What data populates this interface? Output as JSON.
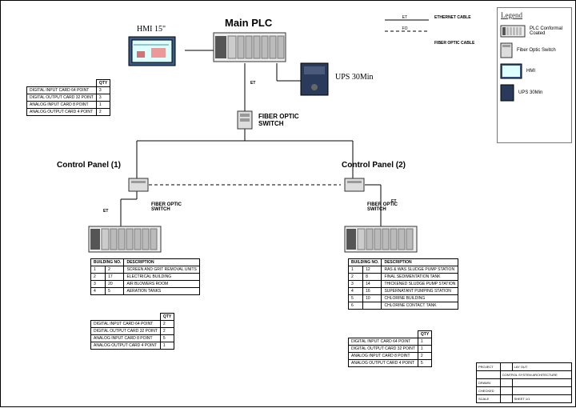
{
  "title_main": "Main  PLC",
  "hmi_label": "HMI 15\"",
  "ups_label": "UPS 30Min",
  "cable_legend": {
    "et_abbr": "ET",
    "et_name": "ETHERNET CABLE",
    "fo_abbr": "FO",
    "fo_name": "FIBER OPTIC CABLE"
  },
  "connection_labels": {
    "et1": "ET",
    "et2": "ET",
    "et3": "ET"
  },
  "fos_center": "FIBER OPTIC\nSWITCH",
  "cp1": "Control Panel (1)",
  "cp2": "Control Panel (2)",
  "fos1": "FIBER OPTIC\nSWITCH",
  "fos2": "FIBER OPTIC\nSWITCH",
  "cards_top": {
    "header_qty": "QTY",
    "rows": [
      {
        "name": "DIGITAL INPUT CARD 64 POINT",
        "qty": "3"
      },
      {
        "name": "DIGITAL OUTPUT CARD 32 POINT",
        "qty": "3"
      },
      {
        "name": "ANALOG INPUT CARD 8 POINT",
        "qty": "1"
      },
      {
        "name": "ANALOG OUTPUT CARD 4 POINT",
        "qty": "2"
      }
    ]
  },
  "panel1_bldg": {
    "hdr_col1": "BUILDING NO.",
    "hdr_col2": "DESCRIPTION",
    "rows": [
      {
        "a": "1",
        "b": "2",
        "desc": "SCREEN AND GRIT REMOVAL UNITS"
      },
      {
        "a": "2",
        "b": "17",
        "desc": "ELECTRICAL BUILDING"
      },
      {
        "a": "3",
        "b": "20",
        "desc": "AIR BLOWERS ROOM"
      },
      {
        "a": "4",
        "b": "5",
        "desc": "AERATION TANKS"
      }
    ]
  },
  "panel1_cards": {
    "header_qty": "QTY",
    "rows": [
      {
        "name": "DIGITAL INPUT CARD 64 POINT",
        "qty": "2"
      },
      {
        "name": "DIGITAL OUTPUT CARD 32 POINT",
        "qty": "2"
      },
      {
        "name": "ANALOG INPUT CARD 8 POINT",
        "qty": "5"
      },
      {
        "name": "ANALOG OUTPUT CARD 4 POINT",
        "qty": "1"
      }
    ]
  },
  "panel2_bldg": {
    "hdr_col1": "BUILDING NO.",
    "hdr_col2": "DESCRIPTION",
    "rows": [
      {
        "a": "1",
        "b": "12",
        "desc": "RAS & WAS SLUDGE PUMP STATION"
      },
      {
        "a": "2",
        "b": "8",
        "desc": "FINAL SEDIMENTATION TANK"
      },
      {
        "a": "3",
        "b": "14",
        "desc": "THICKENED SLUDGE PUMP STATION"
      },
      {
        "a": "4",
        "b": "16",
        "desc": "SUPERNATANT PUMPING STATION"
      },
      {
        "a": "5",
        "b": "10",
        "desc": "CHLORINE BUILDING"
      },
      {
        "a": "6",
        "b": "",
        "desc": "CHLORINE CONTACT TANK"
      }
    ]
  },
  "panel2_cards": {
    "header_qty": "QTY",
    "rows": [
      {
        "name": "DIGITAL INPUT CARD 64 POINT",
        "qty": "1"
      },
      {
        "name": "DIGITAL OUTPUT CARD 32 POINT",
        "qty": "1"
      },
      {
        "name": "ANALOG INPUT CARD 8 POINT",
        "qty": "2"
      },
      {
        "name": "ANALOG OUTPUT CARD 4 POINT",
        "qty": "5"
      }
    ]
  },
  "legend": {
    "title": "Legend",
    "items": [
      {
        "name": "PLC Conformal Coated"
      },
      {
        "name": "Fiber Optic Switch"
      },
      {
        "name": "HMI"
      },
      {
        "name": "UPS 30Min"
      }
    ]
  },
  "titleblock": {
    "rows": [
      [
        "PROJECT",
        "",
        "LAY OUT"
      ],
      [
        "",
        "CONTROL SYSTEM ARCHITECTURE",
        ""
      ],
      [
        "DRAWN",
        "",
        ""
      ],
      [
        "CHECKED",
        "",
        ""
      ],
      [
        "SCALE",
        "",
        "SHEET 1/1"
      ]
    ]
  }
}
